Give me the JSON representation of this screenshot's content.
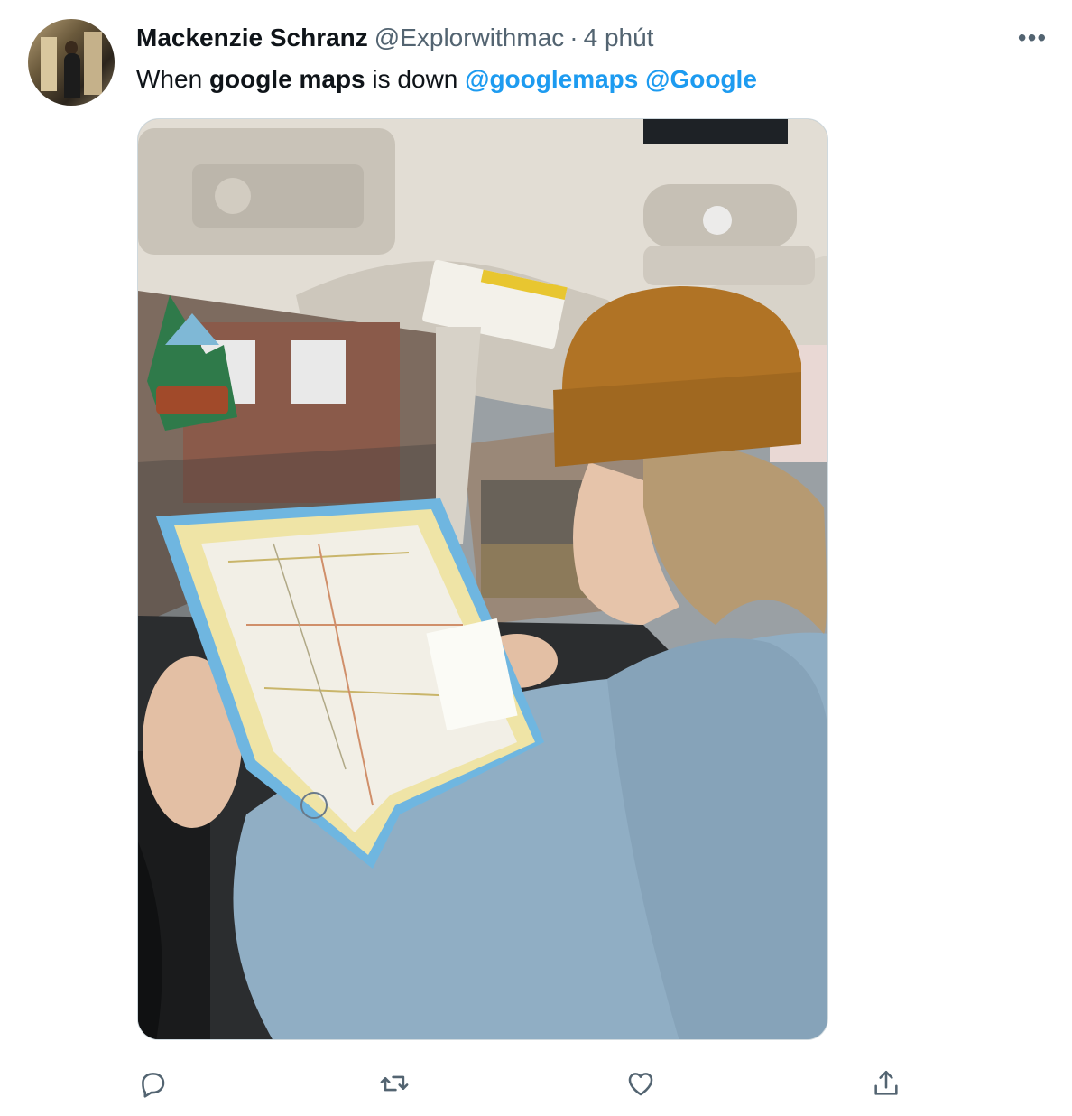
{
  "tweet": {
    "author_name": "Mackenzie Schranz",
    "author_handle": "@Explorwithmac",
    "separator": "·",
    "timestamp": "4 phút",
    "more_label": "•••",
    "text": {
      "part1": "When ",
      "bold": "google maps",
      "part2": " is down ",
      "mention1": "@googlemaps",
      "space": " ",
      "mention2": "@Google"
    }
  },
  "media": {
    "icon": "photo"
  },
  "actions": [
    {
      "icon": "reply-icon"
    },
    {
      "icon": "retweet-icon"
    },
    {
      "icon": "like-icon"
    },
    {
      "icon": "share-icon"
    }
  ],
  "colors": {
    "link": "#1d9bf0",
    "secondary_text": "#536471",
    "primary_text": "#0f1419"
  }
}
